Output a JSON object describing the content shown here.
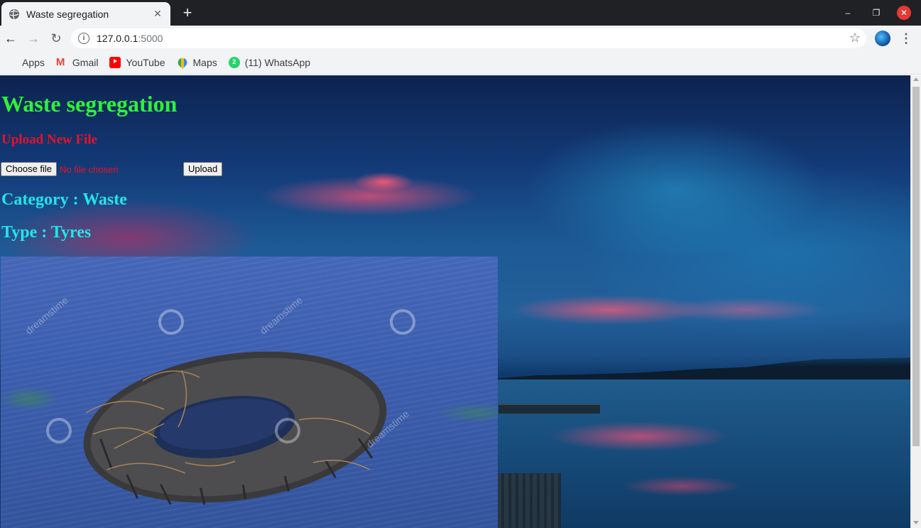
{
  "browser": {
    "tab": {
      "title": "Waste segregation",
      "close": "✕"
    },
    "new_tab": "+",
    "window": {
      "minimize": "–",
      "maximize": "❐",
      "close": "✕"
    },
    "nav": {
      "back": "←",
      "forward": "→",
      "reload": "↻"
    },
    "address": {
      "host": "127.0.0.1",
      "port": ":5000",
      "info": "i",
      "star": "☆"
    },
    "menu": "⋮",
    "bookmarks": [
      {
        "label": "Apps",
        "icon": "apps-grid-icon"
      },
      {
        "label": "Gmail",
        "icon": "gmail-icon",
        "glyph": "M"
      },
      {
        "label": "YouTube",
        "icon": "youtube-icon"
      },
      {
        "label": "Maps",
        "icon": "maps-icon"
      },
      {
        "label": "(11) WhatsApp",
        "icon": "whatsapp-icon",
        "glyph": "2"
      }
    ]
  },
  "page": {
    "heading": "Waste segregation",
    "upload_heading": "Upload New File",
    "choose_file_label": "Choose file",
    "no_file_text": "No file chosen",
    "upload_button": "Upload",
    "category": "Category : Waste",
    "type": "Type : Tyres",
    "result_image": {
      "watermark": "dreamstime"
    }
  },
  "colors": {
    "heading": "#2ef13a",
    "upload_heading": "#e8112a",
    "result_text": "#20e6ea"
  }
}
